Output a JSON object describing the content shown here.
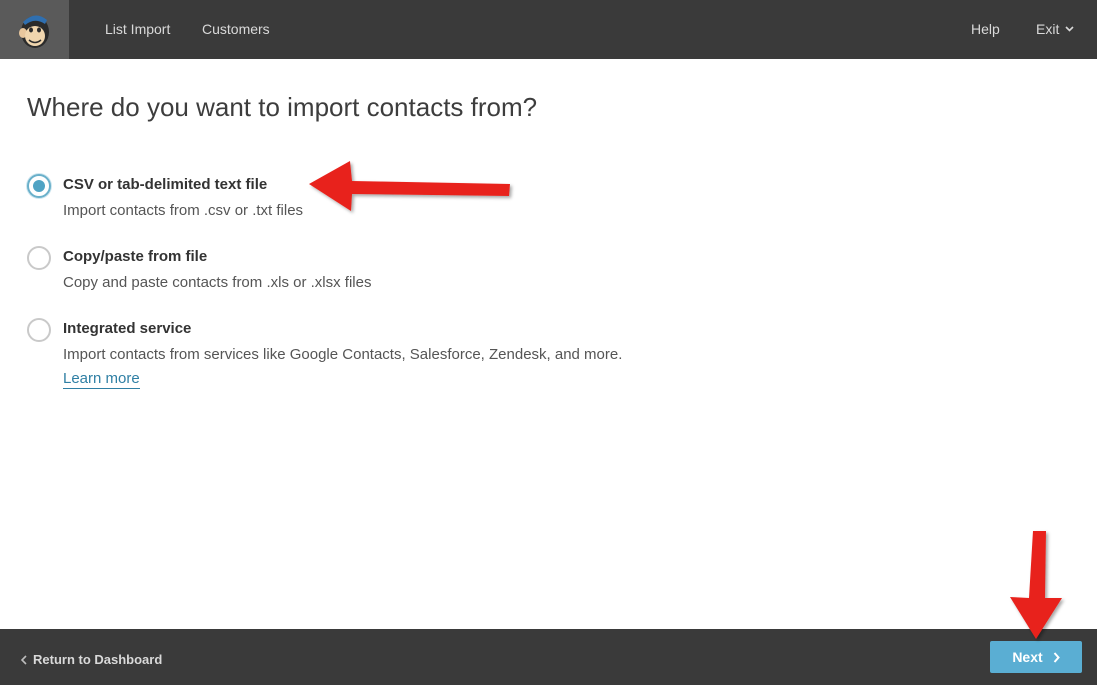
{
  "header": {
    "logo_icon": "chimp-logo-icon",
    "nav": {
      "list_import": "List Import",
      "customers": "Customers",
      "help": "Help",
      "exit": "Exit"
    }
  },
  "main": {
    "title": "Where do you want to import contacts from?",
    "options": [
      {
        "title": "CSV or tab-delimited text file",
        "description": "Import contacts from .csv or .txt files",
        "selected": true
      },
      {
        "title": "Copy/paste from file",
        "description": "Copy and paste contacts from .xls or .xlsx files",
        "selected": false
      },
      {
        "title": "Integrated service",
        "description": "Import contacts from services like Google Contacts, Salesforce, Zendesk, and more.",
        "link": "Learn more",
        "selected": false
      }
    ]
  },
  "footer": {
    "return_label": "Return to Dashboard",
    "next_label": "Next"
  },
  "colors": {
    "topbar": "#3a3a3a",
    "accent": "#5aaed3",
    "radio_selected": "#4fa3c4",
    "annotation_arrow": "#e8231c"
  }
}
